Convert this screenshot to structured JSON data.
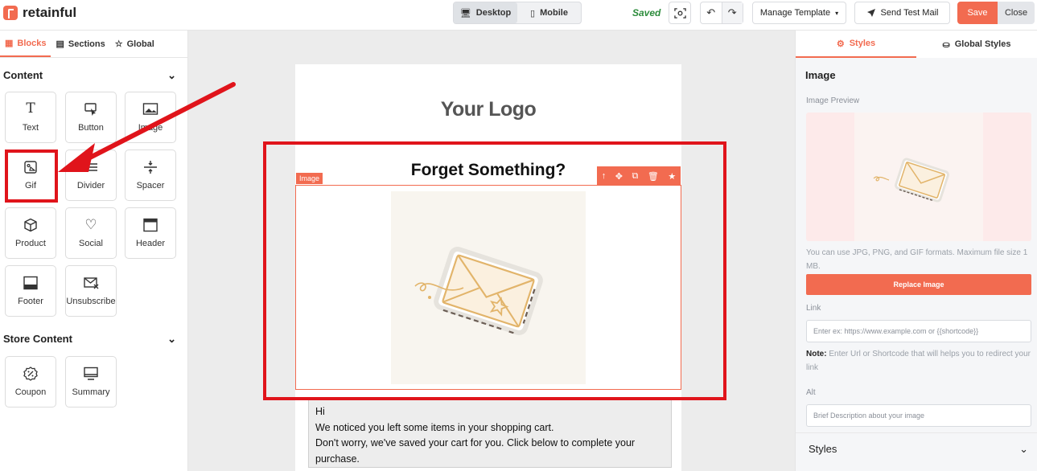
{
  "app": {
    "brand": "retainful",
    "accent": "#f26b50",
    "annotation_color": "#e0141b"
  },
  "topbar": {
    "device_desktop": "Desktop",
    "device_mobile": "Mobile",
    "status": "Saved",
    "manage_template": "Manage Template",
    "send_test": "Send Test Mail",
    "save": "Save",
    "close": "Close"
  },
  "left_panel": {
    "tabs": [
      {
        "label": "Blocks",
        "icon": "grid-icon"
      },
      {
        "label": "Sections",
        "icon": "sections-icon"
      },
      {
        "label": "Global",
        "icon": "star-icon"
      }
    ],
    "content_heading": "Content",
    "blocks": [
      {
        "label": "Text",
        "icon": "text-icon"
      },
      {
        "label": "Button",
        "icon": "cursor-click-icon"
      },
      {
        "label": "Image",
        "icon": "image-icon"
      },
      {
        "label": "Gif",
        "icon": "gif-icon"
      },
      {
        "label": "Divider",
        "icon": "divider-icon"
      },
      {
        "label": "Spacer",
        "icon": "spacer-icon"
      },
      {
        "label": "Product",
        "icon": "cube-icon"
      },
      {
        "label": "Social",
        "icon": "heart-icon"
      },
      {
        "label": "Header",
        "icon": "header-icon"
      },
      {
        "label": "Footer",
        "icon": "footer-icon"
      },
      {
        "label": "Unsubscribe",
        "icon": "mail-x-icon"
      }
    ],
    "store_heading": "Store Content",
    "store_blocks": [
      {
        "label": "Coupon",
        "icon": "badge-percent-icon"
      },
      {
        "label": "Summary",
        "icon": "monitor-icon"
      }
    ]
  },
  "canvas": {
    "logo_text": "Your Logo",
    "heading": "Forget Something?",
    "selected_tag": "Image",
    "body_lines": [
      "Hi",
      "We noticed you left some items in your shopping cart.",
      "Don't worry, we've saved your cart for you. Click below to complete your",
      "purchase."
    ]
  },
  "right_panel": {
    "tabs": [
      "Styles",
      "Global Styles"
    ],
    "title": "Image",
    "preview_label": "Image Preview",
    "help": "You can use JPG, PNG, and GIF formats. Maximum file size 1 MB.",
    "replace_button": "Replace Image",
    "link_label": "Link",
    "link_placeholder": "Enter ex: https://www.example.com or {{shortcode}}",
    "note_label": "Note:",
    "note_text": " Enter Url or Shortcode that will helps you to redirect your link",
    "alt_label": "Alt",
    "alt_placeholder": "Brief Description about your image",
    "styles_section": "Styles"
  }
}
